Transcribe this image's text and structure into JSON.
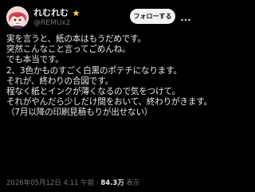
{
  "author": {
    "display_name": "れむれむ",
    "handle": "@REMUx2",
    "badge_icon": "star-badge-icon",
    "badge_color": "#f4c542"
  },
  "follow_button": {
    "label": "フォローする"
  },
  "more_button": {
    "icon": "more-horizontal-icon"
  },
  "tweet": {
    "lines": [
      "実を言うと、紙の本はもうだめです。",
      "突然こんなこと言ってごめんね。",
      "でも本当です。",
      "2、3色かものすごく白黒のポテチになります。",
      "それが、終わりの合図です。",
      "程なく紙とインクが薄くなるので気をつけて。",
      "それがやんだら少しだけ間をおいて、終わりがきます。",
      "（7月以降の印刷見積もりが出せない）"
    ]
  },
  "meta": {
    "time": "2026年05月12日 4:11 午前",
    "separator": " · ",
    "views_count": "84.3万",
    "views_label": " 表示"
  },
  "colors": {
    "background": "#000000",
    "text_primary": "#e7e9ea",
    "text_secondary": "#71767b",
    "follow_button_bg": "#eff3f4",
    "follow_button_text": "#0f1419"
  }
}
